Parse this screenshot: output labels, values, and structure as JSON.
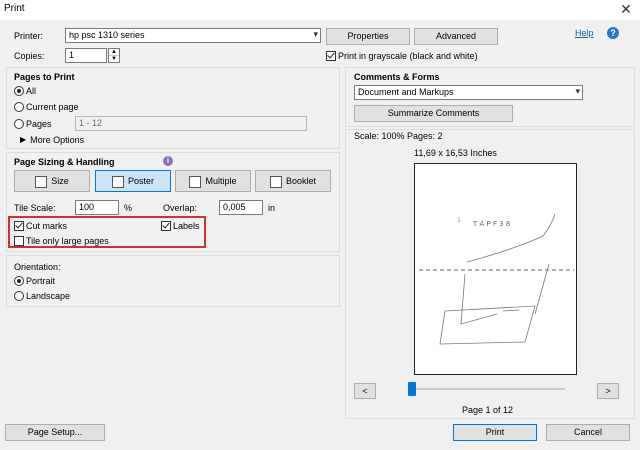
{
  "window": {
    "title": "Print"
  },
  "printer": {
    "label": "Printer:",
    "value": "hp psc 1310 series",
    "properties": "Properties",
    "advanced": "Advanced",
    "help": "Help"
  },
  "copies": {
    "label": "Copies:",
    "value": "1"
  },
  "grayscale": {
    "label": "Print in grayscale (black and white)",
    "checked": true
  },
  "pages": {
    "heading": "Pages to Print",
    "all": "All",
    "current": "Current page",
    "pages": "Pages",
    "pages_value": "1 - 12",
    "more": "More Options"
  },
  "sizing": {
    "heading": "Page Sizing & Handling",
    "size": "Size",
    "poster": "Poster",
    "multiple": "Multiple",
    "booklet": "Booklet",
    "tile_scale_label": "Tile Scale:",
    "tile_scale_value": "100",
    "tile_scale_unit": "%",
    "overlap_label": "Overlap:",
    "overlap_value": "0,005",
    "overlap_unit": "in",
    "cut_marks": "Cut marks",
    "labels": "Labels",
    "tile_large": "Tile only large pages"
  },
  "orientation": {
    "heading": "Orientation:",
    "portrait": "Portrait",
    "landscape": "Landscape"
  },
  "comments": {
    "heading": "Comments & Forms",
    "value": "Document and Markups",
    "summarize": "Summarize Comments"
  },
  "preview": {
    "scale": "Scale: 100% Pages: 2",
    "dims": "11,69 x 16,53 Inches",
    "page_label": "Page 1 of 12",
    "prev": "<",
    "next": ">",
    "slider_fraction": 0.0
  },
  "footer": {
    "page_setup": "Page Setup...",
    "print": "Print",
    "cancel": "Cancel"
  }
}
